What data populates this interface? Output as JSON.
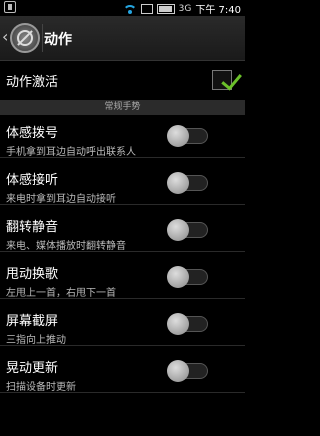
{
  "status_bar": {
    "time": "下午 7:40",
    "network_label": "3G",
    "icons": [
      "usb-icon",
      "wifi-icon",
      "notification-icon",
      "battery-icon"
    ]
  },
  "header": {
    "title": "动作"
  },
  "activate": {
    "label": "动作激活",
    "checked": true,
    "accent": "#6bc02a"
  },
  "section": {
    "title": "常规手势"
  },
  "settings": [
    {
      "title": "体感拨号",
      "subtitle": "手机拿到耳边自动呼出联系人",
      "enabled": false
    },
    {
      "title": "体感接听",
      "subtitle": "来电时拿到耳边自动接听",
      "enabled": false
    },
    {
      "title": "翻转静音",
      "subtitle": "来电、媒体播放时翻转静音",
      "enabled": false
    },
    {
      "title": "甩动换歌",
      "subtitle": "左甩上一首，右甩下一首",
      "enabled": false
    },
    {
      "title": "屏幕截屏",
      "subtitle": "三指向上推动",
      "enabled": false
    },
    {
      "title": "晃动更新",
      "subtitle": "扫描设备时更新",
      "enabled": false
    }
  ]
}
